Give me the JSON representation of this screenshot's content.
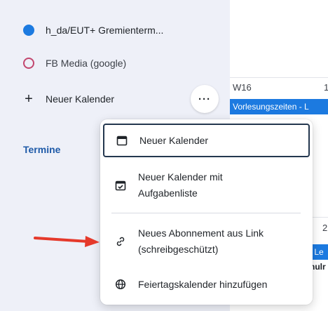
{
  "sidebar": {
    "calendars": [
      {
        "label": "h_da/EUT+ Gremienterm...",
        "color": "#1c7ae0",
        "style": "filled"
      },
      {
        "label": "FB Media (google)",
        "color": "#c2466e",
        "style": "ring"
      }
    ],
    "new_calendar_label": "Neuer Kalender",
    "more_label": "···",
    "section_label": "Termine"
  },
  "calendar_view": {
    "week_label": "W16",
    "day_number_1": "1",
    "event_1": "Vorlesungszeiten - L",
    "day_number_2": "2",
    "event_2": "- Le",
    "event_3": "hulr"
  },
  "menu": {
    "items": [
      {
        "label": "Neuer Kalender",
        "icon": "calendar-icon"
      },
      {
        "label": "Neuer Kalender mit Aufgabenliste",
        "icon": "calendar-check-icon"
      },
      {
        "label": "Neues Abonnement aus Link (schreibgeschützt)",
        "icon": "link-icon"
      },
      {
        "label": "Feiertagskalender hinzufügen",
        "icon": "globe-icon"
      }
    ]
  },
  "annotation": {
    "color": "#e5392b",
    "icon": "red-arrow"
  }
}
